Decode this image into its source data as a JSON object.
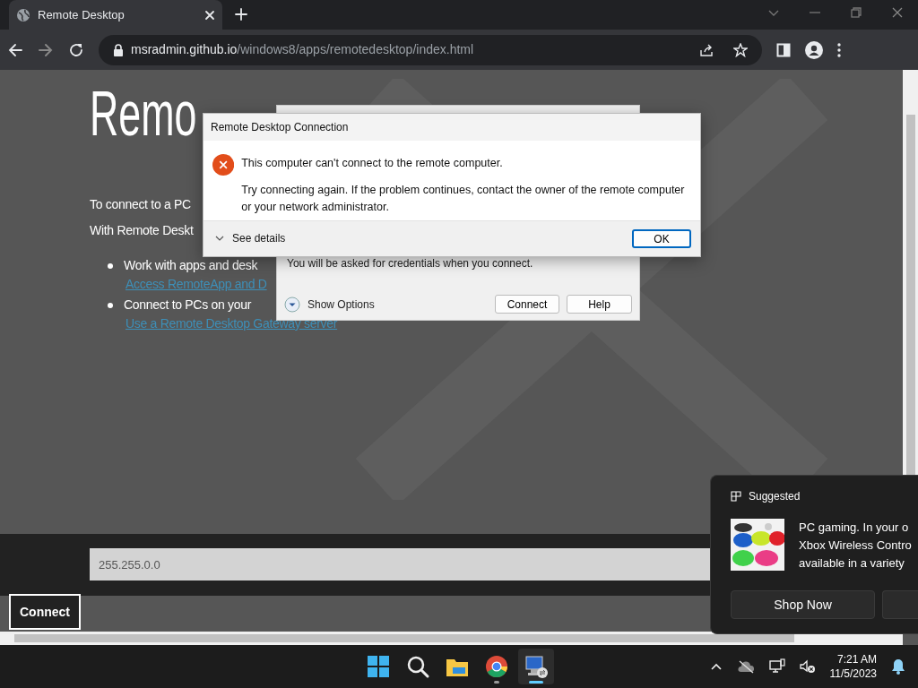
{
  "browser": {
    "tab": {
      "title": "Remote Desktop"
    },
    "address": {
      "host": "msradmin.github.io",
      "path": "/windows8/apps/remotedesktop/index.html"
    }
  },
  "page": {
    "heading": "Remo",
    "paragraphs": [
      "To connect to a PC",
      "With Remote Deskt"
    ],
    "bullets": [
      {
        "text": "Work with apps and desk",
        "link": "Access RemoteApp and D"
      },
      {
        "text": "Connect to PCs on your",
        "link": "Use a Remote Desktop Gateway server"
      }
    ],
    "address_field": {
      "value": "255.255.0.0"
    },
    "connect_button": "Connect"
  },
  "back_dialog": {
    "note": "You will be asked for credentials when you connect.",
    "options": "Show Options",
    "buttons": [
      "Connect",
      "Help"
    ]
  },
  "error_dialog": {
    "title": "Remote Desktop Connection",
    "message": "This computer can't connect to the remote computer.",
    "detail": "Try connecting again. If the problem continues, contact the owner of the remote computer or your network administrator.",
    "details_toggle": "See details",
    "button": "OK"
  },
  "notification": {
    "header": "Suggested",
    "lines": [
      "PC gaming. In your o",
      "Xbox Wireless Contro",
      "available in a variety"
    ],
    "button": "Shop Now"
  },
  "taskbar": {
    "apps": [
      {
        "kind": "start",
        "running": false,
        "active": false
      },
      {
        "kind": "search",
        "running": false,
        "active": false
      },
      {
        "kind": "folder",
        "running": false,
        "active": false
      },
      {
        "kind": "chrome",
        "running": true,
        "active": false
      },
      {
        "kind": "remote",
        "running": true,
        "active": true
      }
    ],
    "clock": {
      "time": "7:21 AM",
      "date": "11/5/2023"
    }
  }
}
